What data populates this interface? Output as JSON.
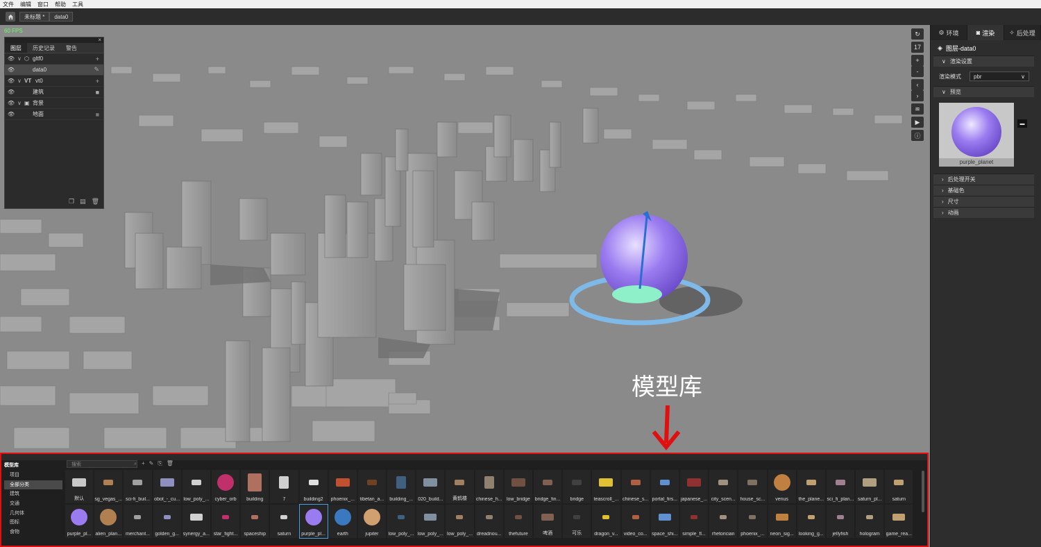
{
  "menu": [
    "文件",
    "编辑",
    "窗口",
    "帮助",
    "工具"
  ],
  "tabs": {
    "untitled": "未标题 *",
    "data": "data0"
  },
  "scene": {
    "fps": "60 FPS",
    "annotation": "模型库"
  },
  "layer_panel": {
    "tabs": [
      "图层",
      "历史记录",
      "警告"
    ],
    "rows": [
      {
        "label": "gltf0",
        "type": "group"
      },
      {
        "label": "data0",
        "type": "item"
      },
      {
        "label": "vt0",
        "prefix": "VT",
        "type": "group"
      },
      {
        "label": "建筑",
        "type": "item"
      },
      {
        "label": "背景",
        "type": "group"
      },
      {
        "label": "地面",
        "type": "item"
      }
    ]
  },
  "right_tools": {
    "zoom_level": "17"
  },
  "right_panel": {
    "tabs": [
      "环境",
      "渲染",
      "后处理"
    ],
    "layer_title": "图层-data0",
    "sec_render": "渲染设置",
    "mode_label": "渲染模式",
    "mode_value": "pbr",
    "sec_preview": "预览",
    "preview_name": "purple_planet",
    "sections": [
      "后处理开关",
      "基础色",
      "尺寸",
      "动画"
    ]
  },
  "library": {
    "title": "模型库",
    "search_placeholder": "搜索",
    "categories": [
      "项目",
      "全部分类",
      "建筑",
      "交通",
      "几何体",
      "图标",
      "食物"
    ],
    "active_category": 1,
    "items_row1": [
      "默认",
      "sg_vegas_...",
      "sci-fi_buil...",
      "obot_-_cu...",
      "low_poly_...",
      "cyber_orb",
      "building",
      "7",
      "building2",
      "phoenix_...",
      "tibetan_a...",
      "building_...",
      "020_build...",
      "黄鹤楼",
      "chinese_h...",
      "low_bridge",
      "bridge_fin...",
      "bridge",
      "teascroll_...",
      "chinese_s...",
      "portal_firs...",
      "japanese_...",
      "city_scen...",
      "house_sc...",
      "venus",
      "the_plane...",
      "sci_fi_plan...",
      "saturn_pl...",
      "saturn"
    ],
    "items_row2": [
      "purple_pl...",
      "alien_plan...",
      "merchant...",
      "golden_g...",
      "synergy_a...",
      "star_fight...",
      "spaceship",
      "saturn",
      "purple_pl...",
      "earth",
      "jupiter",
      "low_poly_...",
      "low_poly_...",
      "low_poly_...",
      "dreadnou...",
      "thefuture",
      "啤酒",
      "可乐",
      "dragon_v...",
      "video_co...",
      "space_shi...",
      "simple_fl...",
      "rhetorician",
      "phoenix_...",
      "neon_sig...",
      "looking_g...",
      "jellyfish",
      "hologram",
      "game_rea..."
    ],
    "selected_row2_index": 8
  },
  "colors": {
    "accent": "#4aa0e0",
    "highlight_border": "#e01010",
    "fps": "#66ff66",
    "planet": "#9b7cf0"
  }
}
